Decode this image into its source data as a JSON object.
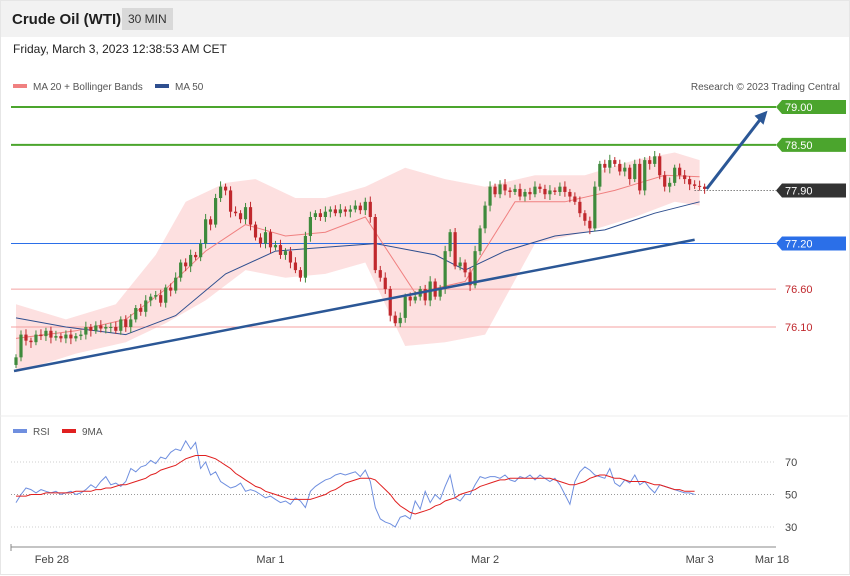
{
  "header": {
    "title": "Crude Oil (WTI)",
    "timeframe": "30 MIN",
    "datetime": "Friday, March 3, 2023 12:38:53 AM CET"
  },
  "copyright": "Research © 2023 Trading Central",
  "colors": {
    "up_candle": "#3e8a3c",
    "down_candle": "#c0282d",
    "bollinger_fill": "#fde0e0",
    "ma20": "#f08080",
    "ma50": "#2f4f8f",
    "trendline": "#2b5796",
    "resistance": "#4ba52d",
    "pivot": "#2b6fe8",
    "support": "#f4a0a0",
    "last_price": "#333333",
    "rsi": "#6f8fdf",
    "rsi_ma": "#e02020"
  },
  "chart_data": [
    {
      "type": "candlestick",
      "title": "Crude Oil (WTI)",
      "interval": "30 MIN",
      "ylim": [
        75.5,
        79.2
      ],
      "legend": [
        {
          "name": "MA 20 + Bollinger Bands",
          "color": "#f08080"
        },
        {
          "name": "MA 50",
          "color": "#2f4f8f"
        }
      ],
      "x_ticks": [
        {
          "label": "Feb 28",
          "index": 8
        },
        {
          "label": "Mar 1",
          "index": 51
        },
        {
          "label": "Mar 2",
          "index": 94
        },
        {
          "label": "Mar 3",
          "index": 137
        },
        {
          "label": "Mar 18",
          "index": 150
        }
      ],
      "levels": [
        {
          "value": 79.0,
          "label": "79.00",
          "role": "resistance"
        },
        {
          "value": 78.5,
          "label": "78.50",
          "role": "resistance"
        },
        {
          "value": 77.9,
          "label": "77.90",
          "role": "last"
        },
        {
          "value": 77.2,
          "label": "77.20",
          "role": "pivot"
        },
        {
          "value": 76.6,
          "label": "76.60",
          "role": "support"
        },
        {
          "value": 76.1,
          "label": "76.10",
          "role": "support"
        }
      ],
      "trendline": {
        "from": [
          0,
          75.52
        ],
        "to": [
          136,
          77.25
        ]
      },
      "arrow": {
        "from": [
          138,
          77.92
        ],
        "to": [
          151,
          78.95
        ]
      },
      "close": [
        75.7,
        76.0,
        75.92,
        75.9,
        76.0,
        75.98,
        76.05,
        75.96,
        75.98,
        75.95,
        76.0,
        75.95,
        75.98,
        76.0,
        76.1,
        76.05,
        76.12,
        76.08,
        76.1,
        76.1,
        76.05,
        76.2,
        76.1,
        76.2,
        76.35,
        76.3,
        76.45,
        76.5,
        76.52,
        76.42,
        76.62,
        76.58,
        76.75,
        76.95,
        76.9,
        77.05,
        77.02,
        77.2,
        77.52,
        77.45,
        77.8,
        77.95,
        77.9,
        77.62,
        77.6,
        77.52,
        77.68,
        77.45,
        77.28,
        77.2,
        77.35,
        77.15,
        77.18,
        77.05,
        77.1,
        76.95,
        76.85,
        76.75,
        77.3,
        77.55,
        77.6,
        77.55,
        77.62,
        77.65,
        77.6,
        77.65,
        77.62,
        77.65,
        77.7,
        77.64,
        77.75,
        77.55,
        76.85,
        76.75,
        76.6,
        76.25,
        76.15,
        76.22,
        76.5,
        76.45,
        76.5,
        76.6,
        76.45,
        76.7,
        76.5,
        76.6,
        77.1,
        77.35,
        76.9,
        76.95,
        76.82,
        76.65,
        77.1,
        77.4,
        77.7,
        77.95,
        77.85,
        77.98,
        77.9,
        77.88,
        77.92,
        77.82,
        77.88,
        77.85,
        77.95,
        77.92,
        77.85,
        77.9,
        77.88,
        77.95,
        77.88,
        77.82,
        77.75,
        77.6,
        77.5,
        77.4,
        77.95,
        78.25,
        78.2,
        78.3,
        78.25,
        78.15,
        78.2,
        78.05,
        78.25,
        77.9,
        78.3,
        78.25,
        78.35,
        78.1,
        77.95,
        78.0,
        78.2,
        78.1,
        78.05,
        77.98,
        77.96,
        77.95,
        77.92
      ],
      "series": [
        {
          "name": "MA 20 + Bollinger Bands",
          "points": [
            [
              0,
              75.95
            ],
            [
              12,
              76.05
            ],
            [
              22,
              76.2
            ],
            [
              30,
              76.6
            ],
            [
              38,
              77.1
            ],
            [
              46,
              77.45
            ],
            [
              54,
              77.3
            ],
            [
              62,
              77.35
            ],
            [
              70,
              77.55
            ],
            [
              80,
              76.55
            ],
            [
              90,
              76.7
            ],
            [
              100,
              77.75
            ],
            [
              110,
              77.75
            ],
            [
              120,
              77.9
            ],
            [
              130,
              78.1
            ],
            [
              137,
              78.08
            ]
          ]
        },
        {
          "name": "MA 20 upper band",
          "points": [
            [
              0,
              76.4
            ],
            [
              10,
              76.2
            ],
            [
              20,
              76.4
            ],
            [
              28,
              77.05
            ],
            [
              34,
              77.75
            ],
            [
              42,
              78.0
            ],
            [
              48,
              78.05
            ],
            [
              56,
              77.8
            ],
            [
              62,
              77.8
            ],
            [
              70,
              77.95
            ],
            [
              78,
              78.2
            ],
            [
              86,
              78.05
            ],
            [
              94,
              77.95
            ],
            [
              104,
              78.1
            ],
            [
              114,
              78.1
            ],
            [
              124,
              78.3
            ],
            [
              132,
              78.4
            ],
            [
              137,
              78.3
            ]
          ]
        },
        {
          "name": "MA 20 lower band",
          "points": [
            [
              0,
              75.5
            ],
            [
              12,
              75.75
            ],
            [
              22,
              75.9
            ],
            [
              30,
              76.15
            ],
            [
              38,
              76.45
            ],
            [
              46,
              76.85
            ],
            [
              54,
              76.75
            ],
            [
              62,
              76.8
            ],
            [
              70,
              76.95
            ],
            [
              78,
              75.85
            ],
            [
              86,
              75.9
            ],
            [
              94,
              76.0
            ],
            [
              104,
              77.2
            ],
            [
              114,
              77.35
            ],
            [
              124,
              77.55
            ],
            [
              132,
              77.75
            ],
            [
              137,
              77.7
            ]
          ]
        },
        {
          "name": "MA 50",
          "points": [
            [
              0,
              76.22
            ],
            [
              10,
              76.1
            ],
            [
              22,
              76.0
            ],
            [
              32,
              76.25
            ],
            [
              42,
              76.8
            ],
            [
              52,
              77.1
            ],
            [
              62,
              77.15
            ],
            [
              72,
              77.2
            ],
            [
              84,
              77.05
            ],
            [
              90,
              76.85
            ],
            [
              98,
              77.1
            ],
            [
              108,
              77.3
            ],
            [
              118,
              77.38
            ],
            [
              128,
              77.6
            ],
            [
              137,
              77.75
            ]
          ]
        }
      ]
    },
    {
      "type": "line",
      "ylim": [
        25,
        85
      ],
      "y_ticks": [
        70,
        50,
        30
      ],
      "legend": [
        {
          "name": "RSI",
          "color": "#6f8fdf"
        },
        {
          "name": "9MA",
          "color": "#e02020"
        }
      ],
      "series": [
        {
          "name": "RSI",
          "values": [
            45,
            50,
            54,
            53,
            51,
            53,
            52,
            51,
            52,
            50,
            51,
            52,
            50,
            51,
            53,
            56,
            54,
            58,
            61,
            56,
            57,
            55,
            58,
            66,
            64,
            67,
            68,
            71,
            69,
            73,
            72,
            76,
            78,
            77,
            83,
            78,
            82,
            66,
            70,
            62,
            64,
            58,
            56,
            54,
            55,
            57,
            52,
            53,
            52,
            50,
            48,
            49,
            47,
            45,
            46,
            44,
            48,
            46,
            42,
            52,
            55,
            57,
            59,
            60,
            62,
            63,
            62,
            63,
            64,
            61,
            65,
            58,
            42,
            35,
            33,
            32,
            30,
            36,
            37,
            35,
            46,
            41,
            52,
            45,
            50,
            47,
            55,
            62,
            48,
            46,
            50,
            50,
            56,
            61,
            60,
            61,
            61,
            60,
            62,
            59,
            58,
            61,
            60,
            62,
            59,
            62,
            60,
            58,
            60,
            56,
            50,
            44,
            58,
            64,
            67,
            65,
            62,
            61,
            60,
            66,
            57,
            55,
            59,
            57,
            62,
            56,
            58,
            54,
            51,
            56,
            55,
            54,
            53,
            52,
            51,
            51,
            50
          ]
        },
        {
          "name": "9MA",
          "values": [
            49,
            49,
            49,
            50,
            50,
            50,
            51,
            51,
            51,
            51,
            51,
            51,
            52,
            52,
            52,
            52,
            53,
            53,
            54,
            54,
            55,
            56,
            56,
            57,
            58,
            59,
            60,
            62,
            63,
            65,
            66,
            67,
            68,
            70,
            72,
            73,
            74,
            74,
            74,
            73,
            72,
            70,
            68,
            66,
            63,
            61,
            59,
            57,
            55,
            54,
            52,
            51,
            50,
            49,
            48,
            47,
            47,
            47,
            47,
            47,
            48,
            49,
            50,
            52,
            53,
            55,
            57,
            58,
            59,
            60,
            60,
            60,
            59,
            56,
            53,
            50,
            46,
            43,
            41,
            39,
            38,
            39,
            40,
            41,
            43,
            44,
            46,
            47,
            48,
            50,
            51,
            52,
            53,
            55,
            56,
            57,
            58,
            59,
            59,
            60,
            60,
            60,
            60,
            60,
            60,
            60,
            60,
            60,
            59,
            58,
            57,
            56,
            56,
            57,
            58,
            60,
            61,
            62,
            62,
            61,
            60,
            60,
            59,
            58,
            58,
            58,
            58,
            57,
            56,
            56,
            55,
            54,
            53,
            53,
            52,
            52,
            52
          ]
        }
      ]
    }
  ]
}
